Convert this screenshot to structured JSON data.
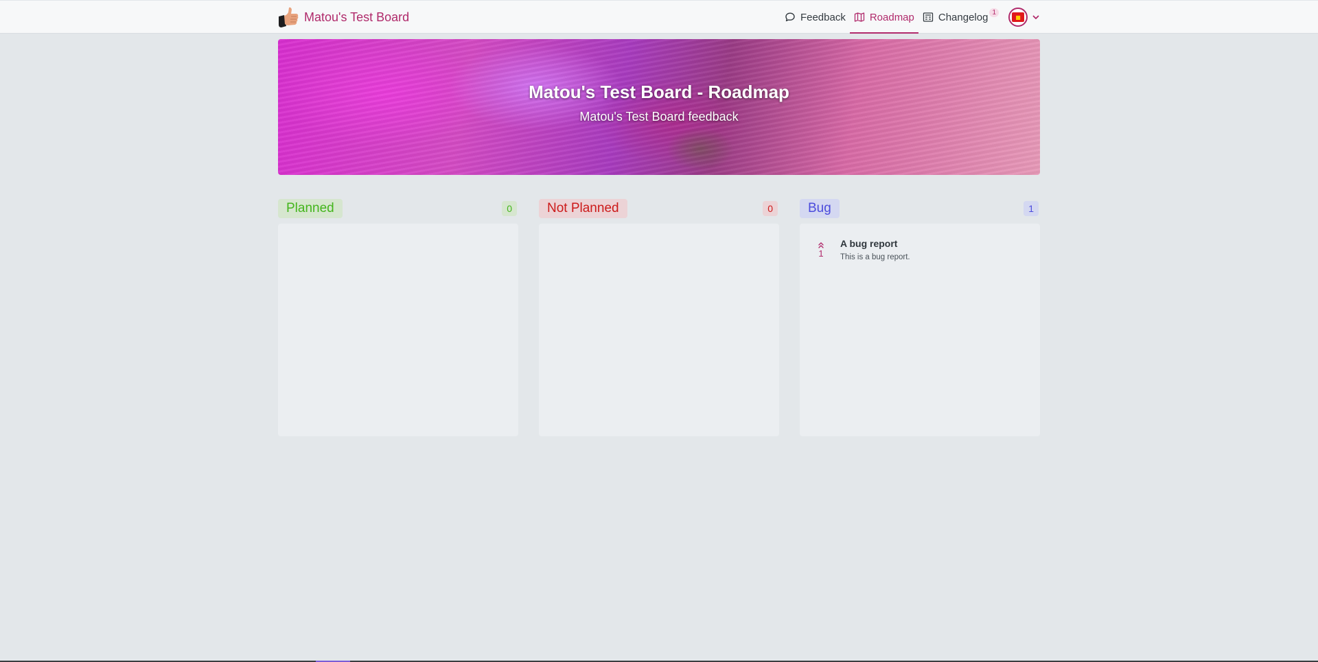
{
  "header": {
    "board_name": "Matou's Test Board",
    "nav": [
      {
        "label": "Feedback",
        "icon": "chat-bubble-icon",
        "active": false
      },
      {
        "label": "Roadmap",
        "icon": "map-icon",
        "active": true
      },
      {
        "label": "Changelog",
        "icon": "newspaper-icon",
        "active": false,
        "badge": "1"
      }
    ],
    "accent_color": "#b02a6b"
  },
  "hero": {
    "title": "Matou's Test Board - Roadmap",
    "subtitle": "Matou's Test Board feedback"
  },
  "columns": [
    {
      "label": "Planned",
      "count": "0",
      "color": "#43b51c",
      "posts": []
    },
    {
      "label": "Not Planned",
      "count": "0",
      "color": "#cc1a1a",
      "posts": []
    },
    {
      "label": "Bug",
      "count": "1",
      "color": "#4b4bdc",
      "posts": [
        {
          "votes": "1",
          "title": "A bug report",
          "description": "This is a bug report."
        }
      ]
    }
  ]
}
